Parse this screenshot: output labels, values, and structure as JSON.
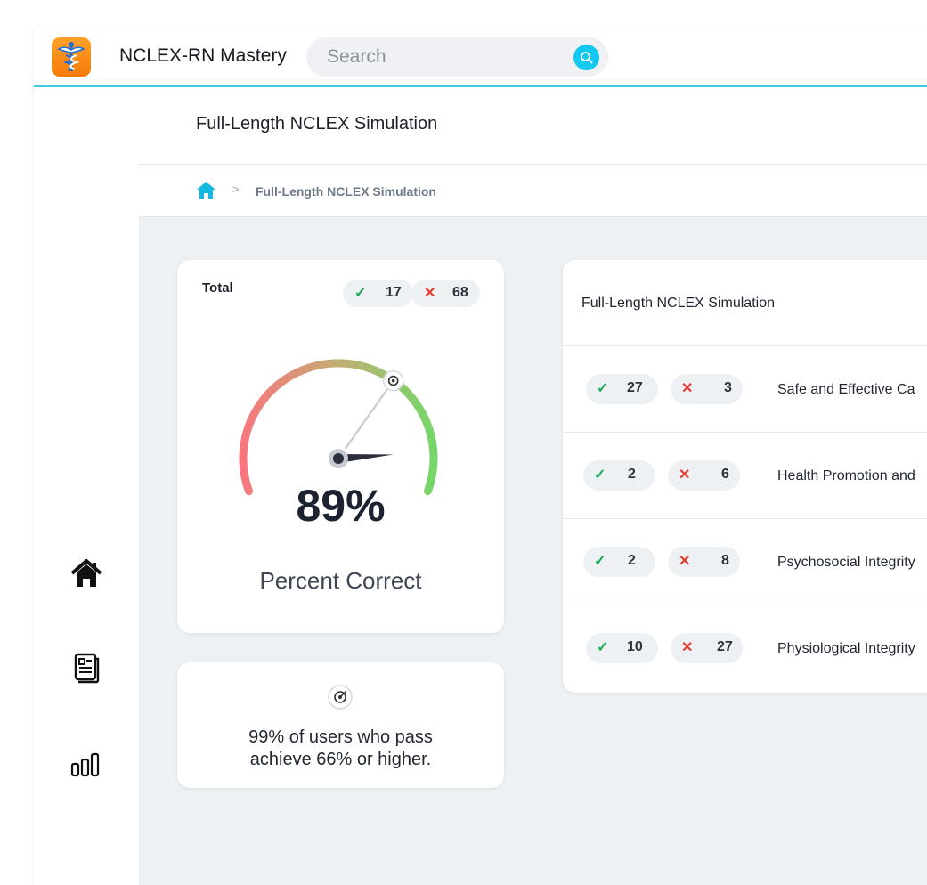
{
  "app": {
    "title": "NCLEX-RN Mastery"
  },
  "search": {
    "placeholder": "Search"
  },
  "sidebar": {
    "items": [
      {
        "name": "home-icon"
      },
      {
        "name": "notes-icon"
      },
      {
        "name": "stats-icon"
      }
    ]
  },
  "header": {
    "title": "Full-Length NCLEX Simulation"
  },
  "breadcrumb": {
    "current": "Full-Length NCLEX Simulation",
    "separator": ">"
  },
  "total": {
    "label": "Total",
    "correct": "17",
    "incorrect": "68",
    "percent": "89%",
    "percent_value": 89,
    "target_value": 66,
    "caption": "Percent Correct"
  },
  "tip": {
    "line1": "99% of users who pass",
    "line2": "achieve 66% or higher."
  },
  "categories": {
    "title": "Full-Length NCLEX Simulation",
    "rows": [
      {
        "correct": "27",
        "incorrect": "3",
        "name": "Safe and Effective Ca"
      },
      {
        "correct": "2",
        "incorrect": "6",
        "name": "Health Promotion and"
      },
      {
        "correct": "2",
        "incorrect": "8",
        "name": "Psychosocial Integrity"
      },
      {
        "correct": "10",
        "incorrect": "27",
        "name": "Physiological Integrity"
      }
    ]
  },
  "colors": {
    "accent": "#3fcbe0",
    "correct": "#1cab5a",
    "incorrect": "#e63b2e",
    "logo": "#f57b07"
  }
}
